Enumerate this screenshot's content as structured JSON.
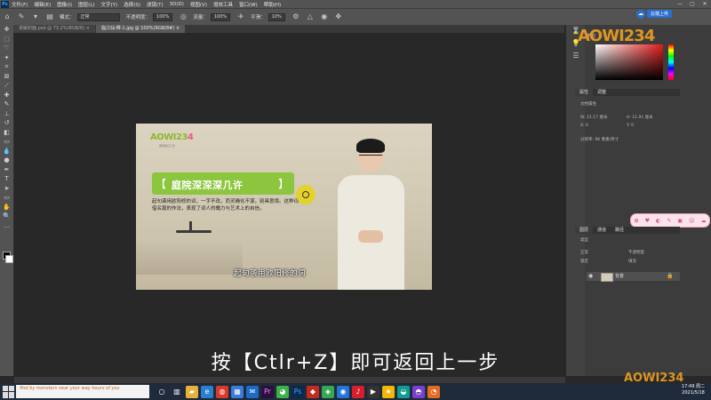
{
  "app": {
    "logo": "Ps"
  },
  "menu": [
    "文件(F)",
    "编辑(E)",
    "图像(I)",
    "图层(L)",
    "文字(Y)",
    "选择(S)",
    "滤镜(T)",
    "3D(D)",
    "视图(V)",
    "增效工具",
    "窗口(W)",
    "帮助(H)"
  ],
  "window_controls": [
    "—",
    "▢",
    "✕"
  ],
  "options": {
    "mode_label": "模式：",
    "mode_value": "正常",
    "opacity_label": "不透明度：",
    "opacity_value": "100%",
    "flow_label": "流量：",
    "flow_value": "100%",
    "smooth_label": "平滑：",
    "smooth_value": "10%"
  },
  "cloud": {
    "label": "云端上传"
  },
  "tabs": [
    {
      "label": "讲解封面.psd @ 73.2%(RGB/8) ×"
    },
    {
      "label": "临江仙-釋-1.jpg @ 100%(RGB/8#) ×"
    }
  ],
  "document": {
    "logo_text": "AOWI23",
    "logo_accent": "4",
    "logo_sub": "拥抱美好工作",
    "banner_title": "庭院深深深几许",
    "bracket_left": "【",
    "bracket_right": "】",
    "paragraph": "起句袭用欧阳修的词，一字不改，而灵确化不谋，别具意境。这种词借名篇的作法，表现了词人的魄力与艺术上的自信。",
    "video_subtitle": "起句袭用欧阳修的词"
  },
  "instruction_subtitle": "按【Ctlr+Z】即可返回上一步",
  "status": {
    "text": ""
  },
  "right": {
    "learn": "学习",
    "watermark": "AOWI234",
    "tab_properties": "属性",
    "tab_adjust": "调整",
    "doc_props": "文档属性",
    "w": "W: 21.17 厘米",
    "h": "H: 11.91 厘米",
    "x": "X: 0",
    "y": "Y: 0",
    "resolution": "分辨率: 96 像素/英寸",
    "layers_tabs": [
      "图层",
      "通道",
      "路径"
    ],
    "kind": "类型",
    "blend": "正常",
    "opacity": "不透明度",
    "lock": "锁定",
    "fill": "填充",
    "layer_name": "背景"
  },
  "taskbar": {
    "search_text": "find by monsters near your way hours of you",
    "time": "17:49 周二",
    "date": "2021/5/18"
  },
  "colors": {
    "banner": "#8cc63f",
    "brand_pink": "#e65a8c",
    "watermark": "#f0a020"
  }
}
